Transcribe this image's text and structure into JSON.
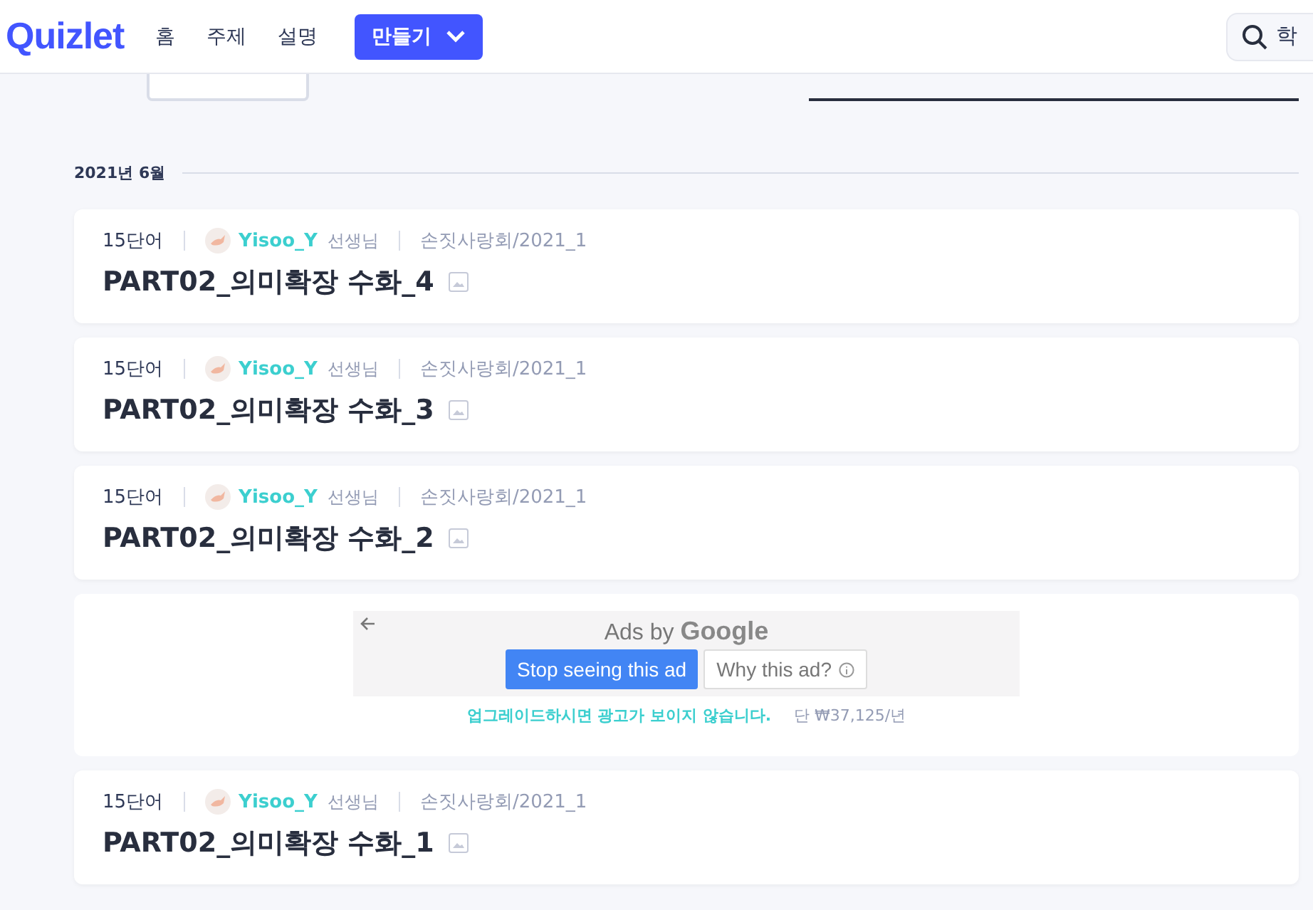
{
  "header": {
    "logo": "Quizlet",
    "nav": [
      {
        "label": "홈"
      },
      {
        "label": "주제"
      },
      {
        "label": "설명"
      }
    ],
    "create_button": "만들기",
    "search": {
      "placeholder": "학"
    }
  },
  "group": {
    "date": "2021년 6월"
  },
  "items": [
    {
      "kind": "set",
      "terms": "15단어",
      "author": "Yisoo_Y",
      "role": "선생님",
      "folder": "손짓사랑회/2021_1",
      "title": "PART02_의미확장 수화_4"
    },
    {
      "kind": "set",
      "terms": "15단어",
      "author": "Yisoo_Y",
      "role": "선생님",
      "folder": "손짓사랑회/2021_1",
      "title": "PART02_의미확장 수화_3"
    },
    {
      "kind": "set",
      "terms": "15단어",
      "author": "Yisoo_Y",
      "role": "선생님",
      "folder": "손짓사랑회/2021_1",
      "title": "PART02_의미확장 수화_2"
    },
    {
      "kind": "ad",
      "ads_by": "Ads by",
      "brand": "Google",
      "stop_button": "Stop seeing this ad",
      "why_button": "Why this ad?",
      "upgrade_link": "업그레이드하시면 광고가 보이지 않습니다.",
      "price": "단 ₩37,125/년"
    },
    {
      "kind": "set",
      "terms": "15단어",
      "author": "Yisoo_Y",
      "role": "선생님",
      "folder": "손짓사랑회/2021_1",
      "title": "PART02_의미확장 수화_1"
    }
  ]
}
